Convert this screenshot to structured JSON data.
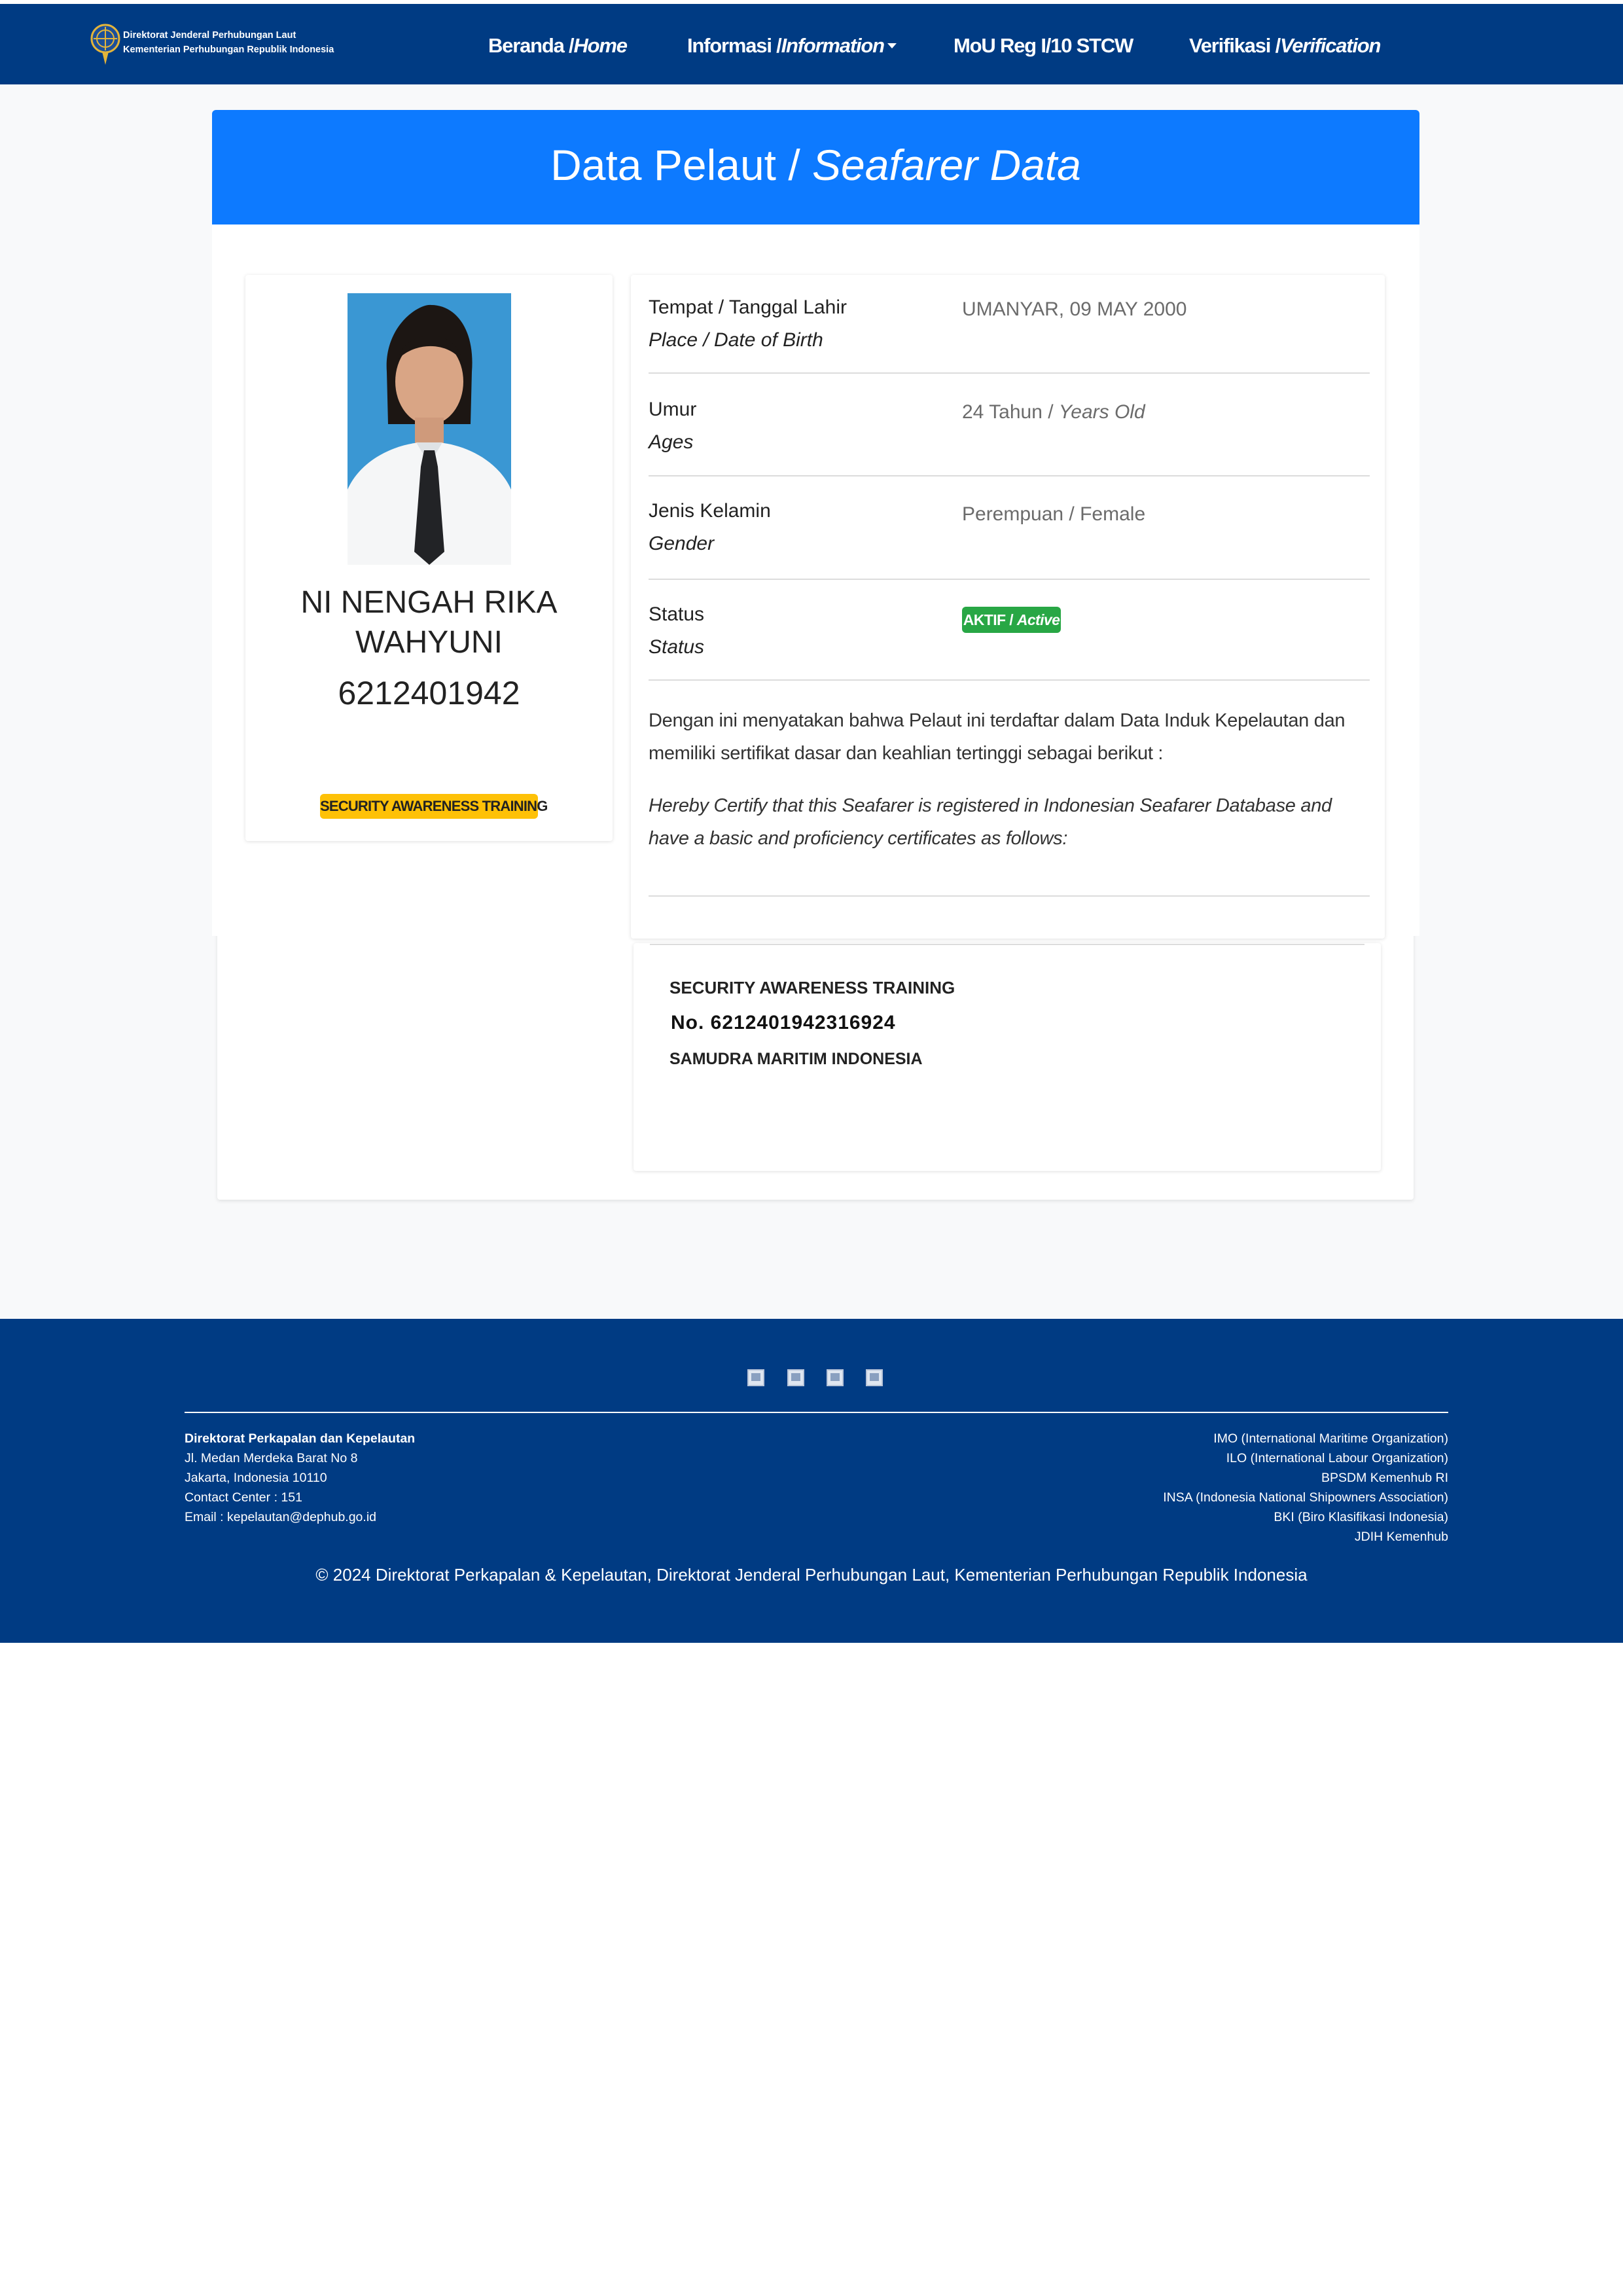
{
  "navbar": {
    "logo_line1": "Direktorat Jenderal Perhubungan Laut",
    "logo_line2": "Kementerian Perhubungan Republik Indonesia",
    "items": [
      {
        "label": "Beranda /",
        "label_italic": "Home"
      },
      {
        "label": "Informasi /",
        "label_italic": "Information"
      },
      {
        "label": "MoU Reg I/10 STCW",
        "label_italic": ""
      },
      {
        "label": "Verifikasi /",
        "label_italic": "Verification"
      }
    ]
  },
  "header": {
    "title": "Data Pelaut / ",
    "title_italic": "Seafarer Data"
  },
  "profile": {
    "name_line1": "NI NENGAH RIKA",
    "name_line2": "WAHYUNI",
    "seafarer_code": "6212401942",
    "badge": "SECURITY AWARENESS TRAINING"
  },
  "info": {
    "rows": [
      {
        "label": "Tempat / Tanggal Lahir",
        "label_en": "Place / Date of Birth",
        "value": "UMANYAR, 09 MAY 2000",
        "value_en": ""
      },
      {
        "label": "Umur",
        "label_en": "Ages",
        "value": "24 Tahun / ",
        "value_en": "Years Old"
      },
      {
        "label": "Jenis Kelamin",
        "label_en": "Gender",
        "value": "Perempuan / Female",
        "value_en": ""
      },
      {
        "label": "Status",
        "label_en": "Status",
        "value": "AKTIF / ",
        "value_en": "Active"
      }
    ],
    "statement_id": "Dengan ini menyatakan bahwa Pelaut ini terdaftar dalam Data Induk Kepelautan dan memiliki sertifikat dasar dan keahlian tertinggi sebagai berikut :",
    "statement_en": "Hereby Certify that this Seafarer is registered in Indonesian Seafarer Database and have a basic and proficiency certificates as follows:"
  },
  "certificate": {
    "name": "SECURITY AWARENESS TRAINING",
    "number": "No. 6212401942316924",
    "institution": "SAMUDRA MARITIM INDONESIA"
  },
  "footer": {
    "left": [
      "Direktorat Perkapalan dan Kepelautan",
      "Jl. Medan Merdeka Barat No 8",
      "Jakarta, Indonesia 10110",
      "Contact Center : 151",
      "Email : kepelautan@dephub.go.id"
    ],
    "right": [
      "IMO (International Maritime Organization)",
      "ILO (International Labour Organization)",
      "BPSDM Kemenhub RI",
      "INSA (Indonesia National Shipowners Association)",
      "BKI (Biro Klasifikasi Indonesia)",
      "JDIH Kemenhub"
    ],
    "copyright": "© 2024 Direktorat Perkapalan & Kepelautan, Direktorat Jenderal Perhubungan Laut, Kementerian Perhubungan Republik Indonesia"
  },
  "colors": {
    "navbar": "#003b83",
    "header": "#0d7aff",
    "badge_yellow": "#fec107",
    "badge_green": "#28a745"
  }
}
